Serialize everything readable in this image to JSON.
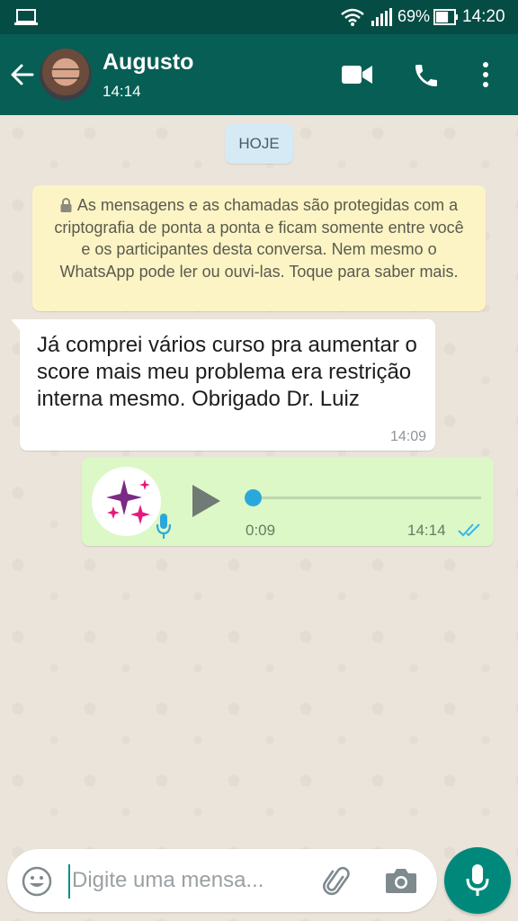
{
  "status_bar": {
    "battery_percent": "69%",
    "time": "14:20",
    "battery_level": 0.69,
    "icons": [
      "laptop-icon",
      "wifi-icon",
      "signal-icon",
      "battery-icon"
    ]
  },
  "header": {
    "contact_name": "Augusto",
    "last_seen": "14:14",
    "icons": [
      "back-arrow-icon",
      "video-call-icon",
      "voice-call-icon",
      "more-vert-icon"
    ],
    "color": "#075e54"
  },
  "chat": {
    "date_chip": "HOJE",
    "encryption_notice": "As mensagens e as chamadas são protegidas com a criptografia de ponta a ponta e ficam somente entre você e os participantes desta conversa. Nem mesmo o WhatsApp pode ler ou ouvi-las. Toque para saber mais.",
    "messages": [
      {
        "direction": "incoming",
        "text": "Já comprei vários curso pra aumentar o score mais meu problema era restrição interna mesmo. Obrigado Dr. Luiz",
        "time": "14:09"
      },
      {
        "direction": "outgoing",
        "type": "voice",
        "duration": "0:09",
        "time": "14:14",
        "playback_progress": 0,
        "status": "read"
      }
    ]
  },
  "composer": {
    "placeholder": "Digite uma mensa...",
    "value": "",
    "icons": [
      "emoji-icon",
      "attach-icon",
      "camera-icon",
      "mic-icon"
    ],
    "accent": "#00897b"
  }
}
